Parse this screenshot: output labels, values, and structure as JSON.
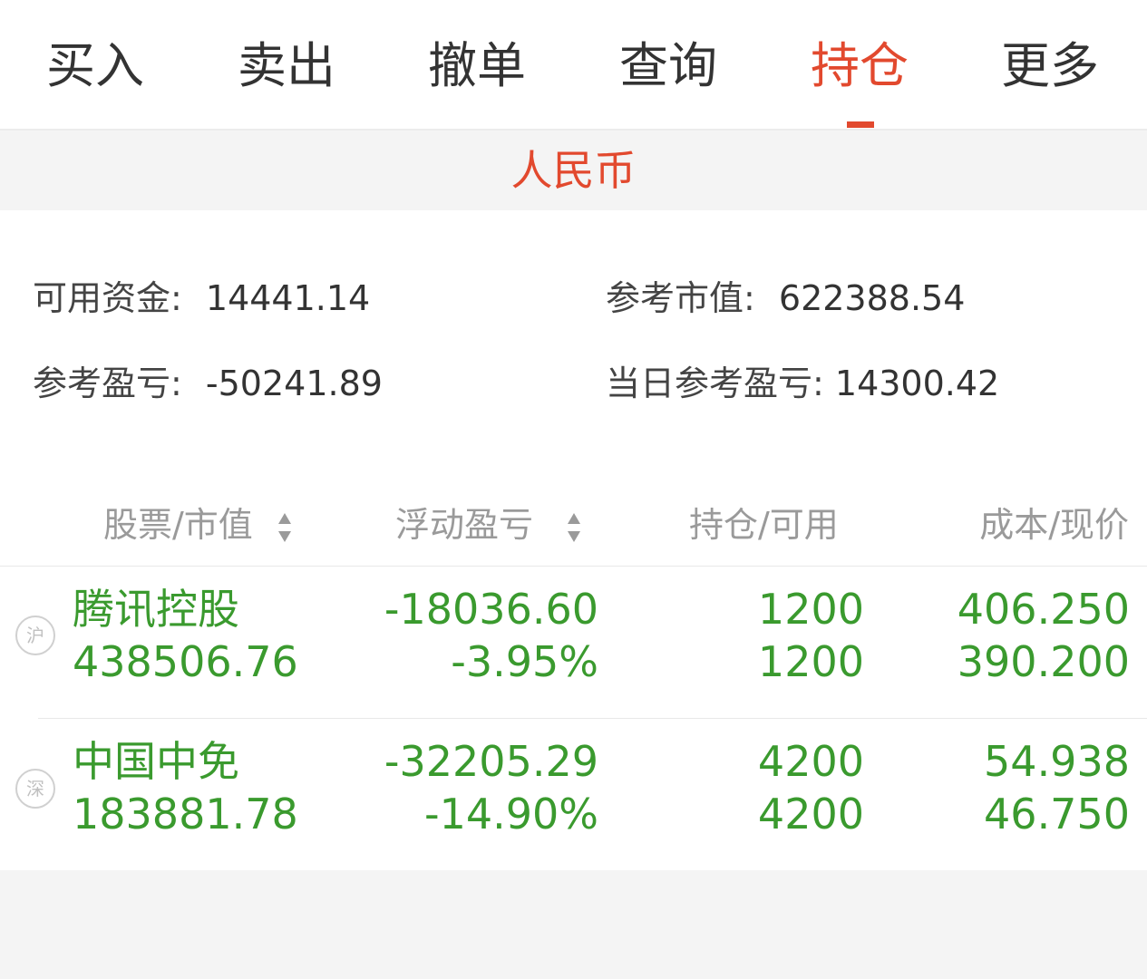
{
  "tabs": [
    "买入",
    "卖出",
    "撤单",
    "查询",
    "持仓",
    "更多"
  ],
  "active_tab": "持仓",
  "currency": "人民币",
  "summary": {
    "available_funds_label": "可用资金:",
    "available_funds_value": "14441.14",
    "market_value_label": "参考市值:",
    "market_value_value": "622388.54",
    "profit_loss_label": "参考盈亏:",
    "profit_loss_value": "-50241.89",
    "daily_profit_loss_label": "当日参考盈亏:",
    "daily_profit_loss_value": "14300.42"
  },
  "columns": {
    "stock_market_value": "股票/市值",
    "floating_pl": "浮动盈亏",
    "position_available": "持仓/可用",
    "cost_price": "成本/现价"
  },
  "holdings": [
    {
      "market": "沪",
      "name": "腾讯控股",
      "market_value": "438506.76",
      "floating_pl": "-18036.60",
      "floating_pl_pct": "-3.95%",
      "position": "1200",
      "available": "1200",
      "cost": "406.250",
      "price": "390.200"
    },
    {
      "market": "深",
      "name": "中国中免",
      "market_value": "183881.78",
      "floating_pl": "-32205.29",
      "floating_pl_pct": "-14.90%",
      "position": "4200",
      "available": "4200",
      "cost": "54.938",
      "price": "46.750"
    }
  ],
  "colors": {
    "accent": "#e2492e",
    "loss_green": "#3a9a2e",
    "header_gray": "#9a9a9a"
  }
}
